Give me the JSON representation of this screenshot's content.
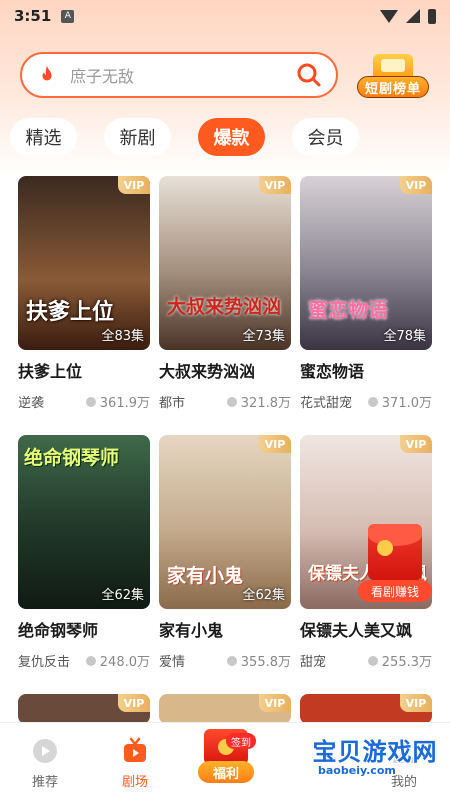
{
  "status_bar": {
    "time": "3:51",
    "notification_letter": "A"
  },
  "search": {
    "placeholder": "庶子无敌"
  },
  "rank_badge": {
    "label": "短剧榜单"
  },
  "tabs": [
    {
      "label": "精选",
      "active": false
    },
    {
      "label": "新剧",
      "active": false
    },
    {
      "label": "爆款",
      "active": true
    },
    {
      "label": "会员",
      "active": false
    }
  ],
  "dramas": [
    {
      "title": "扶爹上位",
      "poster_text": "扶爹上位",
      "episodes": "全83集",
      "tag": "逆袭",
      "plays": "361.9万",
      "vip": "VIP",
      "color": "#7a4b2a"
    },
    {
      "title": "大叔来势汹汹",
      "poster_text": "大叔来势汹汹",
      "episodes": "全73集",
      "tag": "都市",
      "plays": "321.8万",
      "vip": "VIP",
      "color": "#b7a28d"
    },
    {
      "title": "蜜恋物语",
      "poster_text": "蜜恋物语",
      "episodes": "全78集",
      "tag": "花式甜宠",
      "plays": "371.0万",
      "vip": "VIP",
      "color": "#9a8fa6"
    },
    {
      "title": "绝命钢琴师",
      "poster_text": "绝命钢琴师",
      "episodes": "全62集",
      "tag": "复仇反击",
      "plays": "248.0万",
      "vip": "",
      "color": "#2f4a36"
    },
    {
      "title": "家有小鬼",
      "poster_text": "家有小鬼",
      "episodes": "全62集",
      "tag": "爱情",
      "plays": "355.8万",
      "vip": "VIP",
      "color": "#d9c4a8"
    },
    {
      "title": "保镖夫人美又飒",
      "poster_text": "保镖夫人美又飒",
      "episodes": "",
      "tag": "甜宠",
      "plays": "255.3万",
      "vip": "VIP",
      "color": "#d8c6c2"
    }
  ],
  "next_row_vip": "VIP",
  "redpacket": {
    "label": "看剧赚钱"
  },
  "bottom_nav": {
    "recommend": "推荐",
    "theater": "剧场",
    "welfare": "福利",
    "sign_in": "签到",
    "mine": "我的"
  },
  "watermark": {
    "text": "宝贝游戏网",
    "url": "baobeiy.com"
  },
  "colors": {
    "accent": "#ff5a1f",
    "vip_gold": "#e8b15e"
  }
}
